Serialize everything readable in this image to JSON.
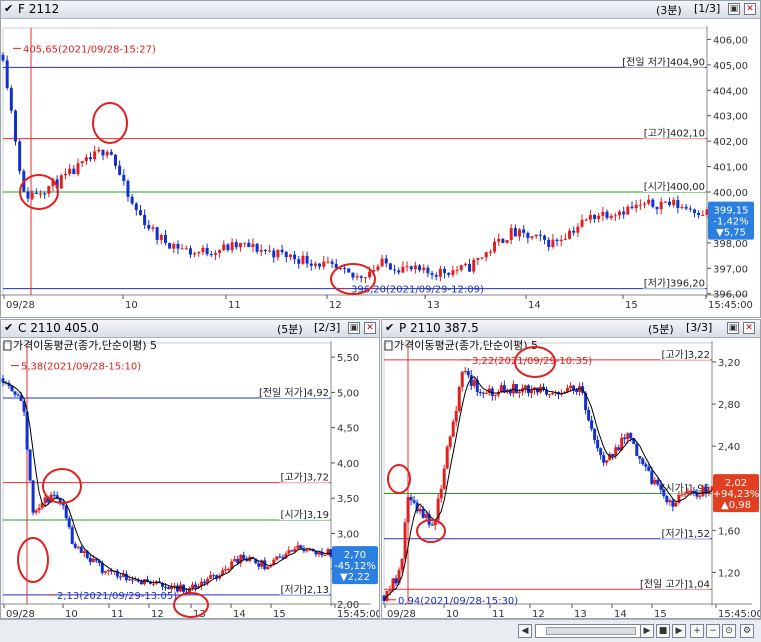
{
  "colors": {
    "up": "#e02020",
    "down": "#1030d0",
    "ma": "#000000",
    "red_line": "#e03030",
    "blue_line": "#2030c0",
    "green_line": "#20a020",
    "badge_down": "#2a7fe0",
    "badge_up": "#e04020",
    "annot": "#e02020"
  },
  "panels": [
    {
      "id": "futures",
      "title": "F 2112",
      "meta": "(3분)",
      "page": "[1/3]",
      "y_ticks": [
        "406,00",
        "405,00",
        "404,00",
        "403,00",
        "402,00",
        "401,00",
        "400,00",
        "399,00",
        "398,00",
        "397,00",
        "396,00"
      ],
      "x_ticks": [
        "09/28",
        "10",
        "11",
        "12",
        "13",
        "14",
        "15",
        "15:45:00"
      ],
      "labels": {
        "prev_low": "[전일 저가]404,90",
        "high": "[고가]402,10",
        "open": "[시가]400,00",
        "low": "[저가]396,20",
        "high_note": "405,65(2021/09/28-15:27)",
        "low_note": "396,20(2021/09/29-12:09)"
      },
      "badge": {
        "price": "399,15",
        "pct": "-1,42%",
        "chg": "▼5,75"
      }
    },
    {
      "id": "call",
      "title": "C 2110 405.0",
      "meta": "(5분)",
      "page": "[2/3]",
      "ma_label": "가격이동평균(종가,단순이평) 5",
      "y_ticks": [
        "5,50",
        "5,00",
        "4,50",
        "4,00",
        "3,50",
        "3,00",
        "2,50",
        "2,00"
      ],
      "x_ticks": [
        "09/28",
        "10",
        "11",
        "12",
        "13",
        "14",
        "15",
        "15:45:00"
      ],
      "labels": {
        "prev_low": "[전일 저가]4,92",
        "high": "[고가]3,72",
        "open": "[시가]3,19",
        "low": "[저가]2,13",
        "high_note": "5,38(2021/09/28-15:10)",
        "low_note": "2,13(2021/09/29-13:05)"
      },
      "badge": {
        "price": "2,70",
        "pct": "-45,12%",
        "chg": "▼2,22"
      }
    },
    {
      "id": "put",
      "title": "P 2110 387.5",
      "meta": "(5분)",
      "page": "[3/3]",
      "ma_label": "가격이동평균(종가,단순이평) 5",
      "y_ticks": [
        "3,20",
        "2,80",
        "2,40",
        "2,00",
        "1,60",
        "1,20"
      ],
      "x_ticks": [
        "09/28",
        "10",
        "11",
        "12",
        "13",
        "14",
        "15",
        "15:45:00"
      ],
      "labels": {
        "high": "[고가]3,22",
        "open": "[시가]1,95",
        "low": "[저가]1,52",
        "prev_high": "[전일 고가]1,04",
        "high_note": "3,22(2021/09/29-10:35)",
        "low_note": "0,94(2021/09/28-15:30)"
      },
      "badge": {
        "price": "2,02",
        "pct": "+94,23%",
        "chg": "▲0,98"
      }
    }
  ],
  "icons": [
    "checkbox-icon",
    "restore-icon",
    "close-icon",
    "scroll-left-icon",
    "scroll-right-icon",
    "stop-icon",
    "play-icon",
    "zoom-in-icon",
    "zoom-out-icon",
    "zoom-reset-icon",
    "settings-icon"
  ]
}
